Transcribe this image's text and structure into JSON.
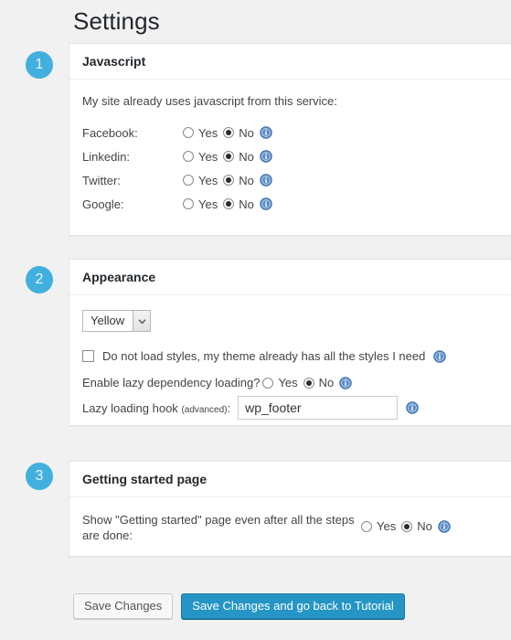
{
  "page": {
    "title": "Settings"
  },
  "colors": {
    "badge": "#42b0de",
    "primary_button": "#2495c4",
    "info_icon": "#5a8cc8",
    "page_background": "#f1f1f1"
  },
  "steps": [
    {
      "number": "1"
    },
    {
      "number": "2"
    },
    {
      "number": "3"
    }
  ],
  "javascript_panel": {
    "header": "Javascript",
    "intro": "My site already uses javascript from this service:",
    "yes_label": "Yes",
    "no_label": "No",
    "info_icon": "info-icon",
    "services": [
      {
        "name": "Facebook:",
        "selected": "No"
      },
      {
        "name": "Linkedin:",
        "selected": "No"
      },
      {
        "name": "Twitter:",
        "selected": "No"
      },
      {
        "name": "Google:",
        "selected": "No"
      }
    ]
  },
  "appearance_panel": {
    "header": "Appearance",
    "style_select": {
      "selected": "Yellow",
      "options": [
        "Yellow"
      ],
      "arrow_icon": "chevron-down-icon"
    },
    "no_styles_checkbox": {
      "label": "Do not load styles, my theme already has all the styles I need",
      "checked": false
    },
    "lazy_loading": {
      "question": "Enable lazy dependency loading?",
      "yes_label": "Yes",
      "no_label": "No",
      "selected": "No"
    },
    "lazy_hook": {
      "label": "Lazy loading hook",
      "label_suffix": "(advanced)",
      "label_colon": ":",
      "value": "wp_footer",
      "placeholder": "wp_footer"
    }
  },
  "getting_started_panel": {
    "header": "Getting started page",
    "question": "Show \"Getting started\" page even after all the steps are done:",
    "yes_label": "Yes",
    "no_label": "No",
    "selected": "No"
  },
  "buttons": {
    "save": "Save Changes",
    "save_and_return": "Save Changes and go back to Tutorial"
  }
}
